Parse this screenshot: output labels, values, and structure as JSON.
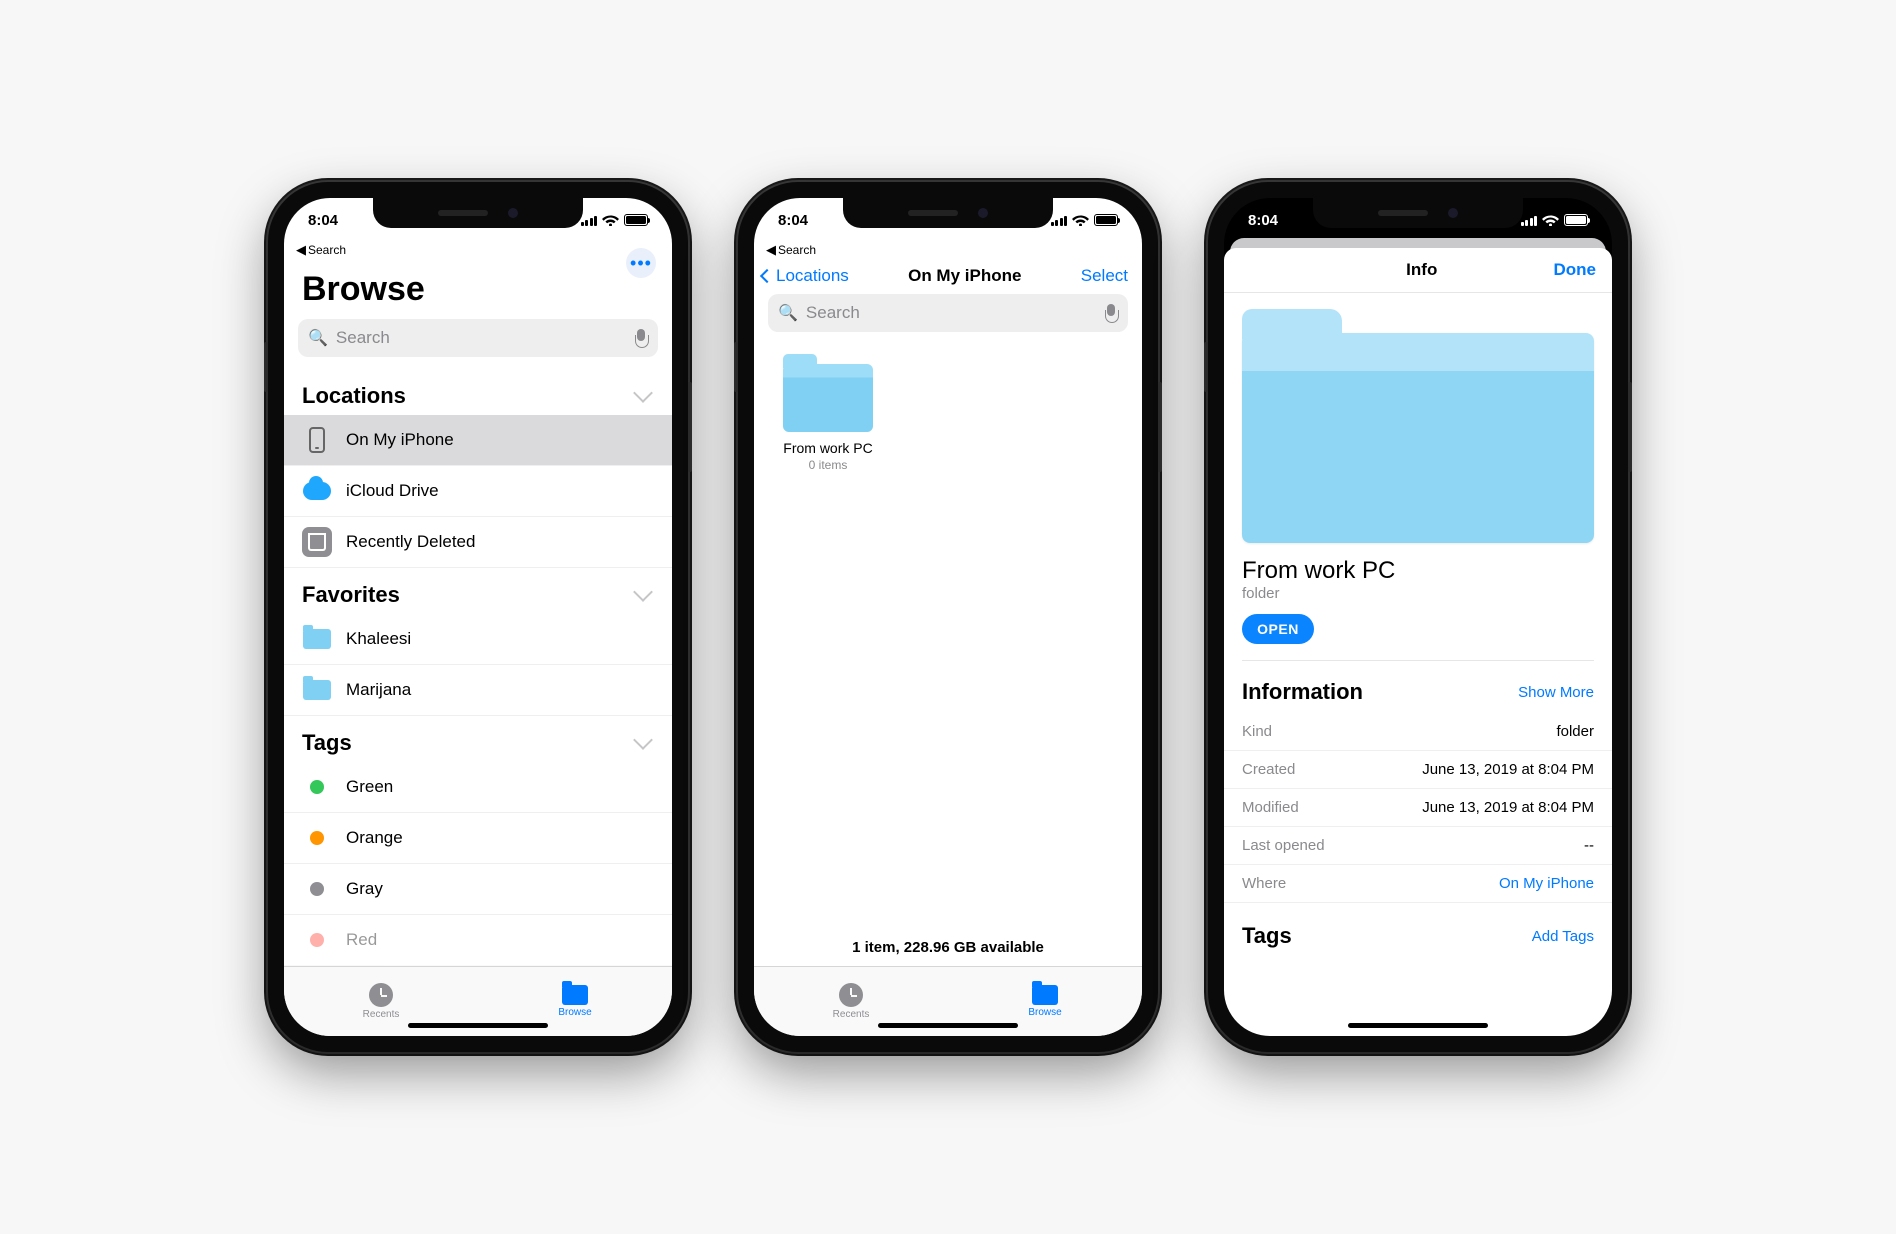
{
  "status": {
    "time": "8:04",
    "back_label": "Search"
  },
  "screen1": {
    "title": "Browse",
    "search_placeholder": "Search",
    "sections": {
      "locations": {
        "header": "Locations",
        "items": [
          {
            "label": "On My iPhone",
            "icon": "phone-device-icon",
            "selected": true
          },
          {
            "label": "iCloud Drive",
            "icon": "cloud-icon"
          },
          {
            "label": "Recently Deleted",
            "icon": "trash-icon"
          }
        ]
      },
      "favorites": {
        "header": "Favorites",
        "items": [
          {
            "label": "Khaleesi",
            "icon": "folder-icon"
          },
          {
            "label": "Marijana",
            "icon": "folder-icon"
          }
        ]
      },
      "tags": {
        "header": "Tags",
        "items": [
          {
            "label": "Green",
            "color": "#34c759"
          },
          {
            "label": "Orange",
            "color": "#ff9500"
          },
          {
            "label": "Gray",
            "color": "#8e8e93"
          },
          {
            "label": "Red",
            "color": "#ff3b30"
          }
        ]
      }
    },
    "tabs": {
      "recents": "Recents",
      "browse": "Browse"
    }
  },
  "screen2": {
    "back_label": "Locations",
    "title": "On My iPhone",
    "select_label": "Select",
    "search_placeholder": "Search",
    "folder": {
      "name": "From work PC",
      "subtitle": "0 items"
    },
    "footer": "1 item, 228.96 GB available",
    "tabs": {
      "recents": "Recents",
      "browse": "Browse"
    }
  },
  "screen3": {
    "title": "Info",
    "done_label": "Done",
    "item_name": "From work PC",
    "item_kind_sub": "folder",
    "open_label": "OPEN",
    "info_header": "Information",
    "show_more": "Show More",
    "rows": {
      "kind": {
        "k": "Kind",
        "v": "folder"
      },
      "created": {
        "k": "Created",
        "v": "June 13, 2019 at 8:04 PM"
      },
      "modified": {
        "k": "Modified",
        "v": "June 13, 2019 at 8:04 PM"
      },
      "last_opened": {
        "k": "Last opened",
        "v": "--"
      },
      "where": {
        "k": "Where",
        "v": "On My iPhone"
      }
    },
    "tags_header": "Tags",
    "add_tags": "Add Tags"
  }
}
